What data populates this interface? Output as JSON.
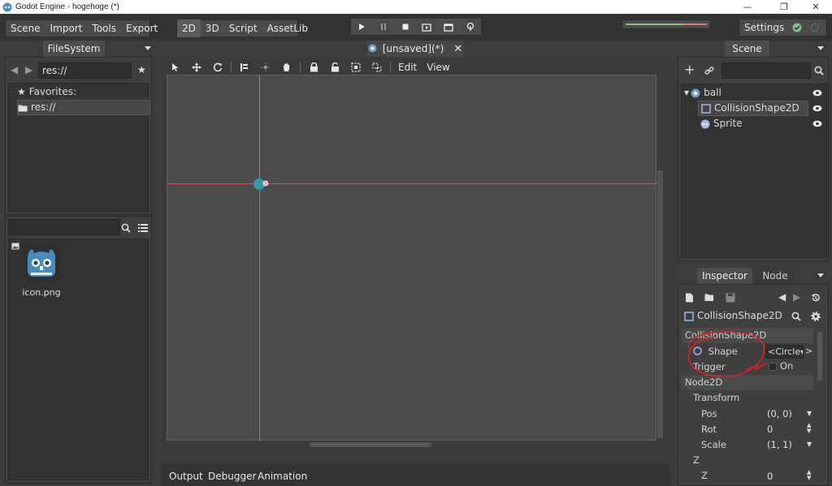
{
  "window": {
    "title": "Godot Engine - hogehoge (*)",
    "controls": [
      "—",
      "❐",
      "✕"
    ]
  },
  "menu": {
    "main": [
      "Scene",
      "Import",
      "Tools",
      "Export"
    ],
    "modes": [
      "2D",
      "3D",
      "Script",
      "AssetLib"
    ],
    "active_mode": "2D",
    "settings_label": "Settings"
  },
  "scene_tab": {
    "label": "[unsaved](*)"
  },
  "filesystem": {
    "tab_label": "FileSystem",
    "path": "res://",
    "favorites_label": "Favorites:",
    "tree_item": "res://",
    "files": [
      {
        "name": "icon.png"
      }
    ]
  },
  "viewport": {
    "menus": [
      "Edit",
      "View"
    ]
  },
  "scene": {
    "tab_label": "Scene",
    "nodes": [
      {
        "name": "ball"
      },
      {
        "name": "CollisionShape2D"
      },
      {
        "name": "Sprite"
      }
    ]
  },
  "inspector": {
    "tabs": [
      "Inspector",
      "Node"
    ],
    "selected_node": "CollisionShape2D",
    "sections": {
      "collision": "CollisionShape2D",
      "node2d": "Node2D"
    },
    "props": {
      "shape_label": "Shape",
      "shape_value": "<Circle",
      "trigger_label": "Trigger",
      "trigger_value": "On",
      "transform_label": "Transform",
      "pos_label": "Pos",
      "pos_value": "(0, 0)",
      "rot_label": "Rot",
      "rot_value": "0",
      "scale_label": "Scale",
      "scale_value": "(1, 1)",
      "z_group_label": "Z",
      "z_label": "Z",
      "z_value": "0"
    }
  },
  "bottom": {
    "tabs": [
      "Output",
      "Debugger",
      "Animation"
    ]
  }
}
